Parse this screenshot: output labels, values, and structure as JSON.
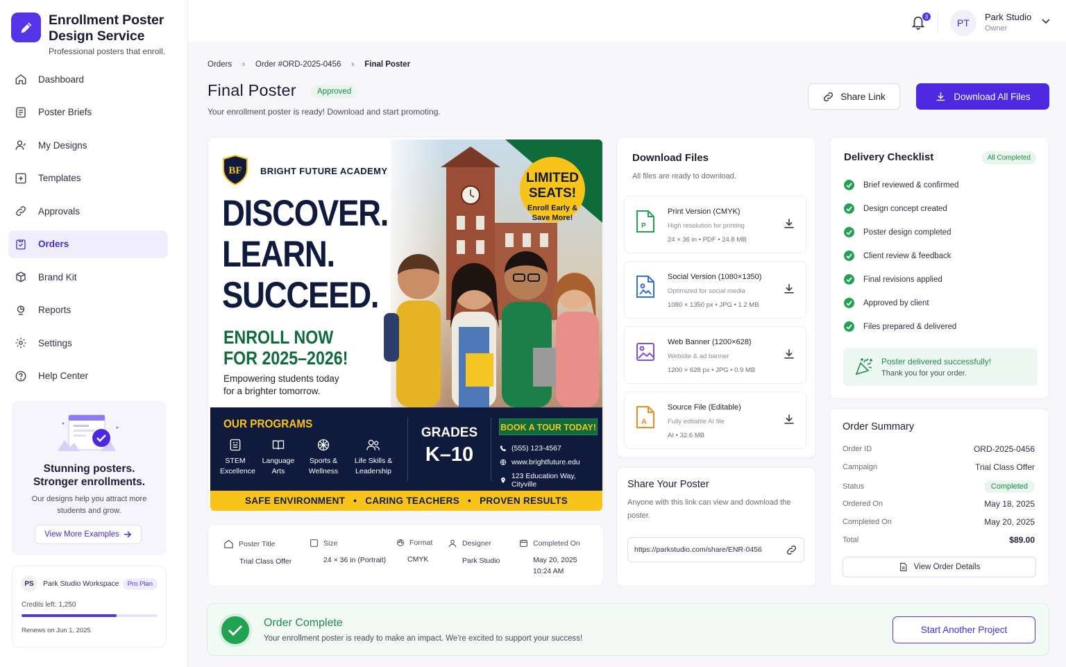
{
  "app": {
    "title": "Enrollment Poster Design Service",
    "title_line1": "Enrollment Poster",
    "title_line2": "Design Service",
    "tagline": "Professional posters that enroll."
  },
  "sidebar": {
    "items": [
      {
        "label": "Dashboard",
        "icon": "home-icon"
      },
      {
        "label": "Poster Briefs",
        "icon": "document-icon"
      },
      {
        "label": "My Designs",
        "icon": "user-icon"
      },
      {
        "label": "Templates",
        "icon": "template-icon"
      },
      {
        "label": "Approvals",
        "icon": "link-icon"
      },
      {
        "label": "Orders",
        "icon": "orders-icon",
        "active": true
      },
      {
        "label": "Brand Kit",
        "icon": "box-icon"
      },
      {
        "label": "Reports",
        "icon": "reports-icon"
      },
      {
        "label": "Settings",
        "icon": "gear-icon"
      },
      {
        "label": "Help Center",
        "icon": "help-icon"
      }
    ],
    "promo": {
      "title_line1": "Stunning posters.",
      "title_line2": "Stronger enrollments.",
      "text": "Our designs help you attract more students and grow.",
      "button": "View More Examples"
    },
    "workspace": {
      "initials": "PS",
      "name": "Park Studio Workspace",
      "plan": "Pro Plan",
      "credits": "Credits left: 1,250",
      "credits_fraction": 0.7,
      "renews": "Renews on Jun 1, 2025"
    }
  },
  "topbar": {
    "notifications": "3",
    "user_initials": "PT",
    "user_name": "Park Studio",
    "user_role": "Owner"
  },
  "breadcrumb": [
    "Orders",
    "Order #ORD-2025-0456",
    "Final Poster"
  ],
  "page": {
    "title": "Final Poster",
    "status": "Approved",
    "subtitle": "Your enrollment poster is ready! Download and start promoting.",
    "share_button": "Share Link",
    "download_button": "Download All Files"
  },
  "poster": {
    "school": "BRIGHT FUTURE ACADEMY",
    "logo_text": "BF",
    "headline": [
      "DISCOVER.",
      "LEARN.",
      "SUCCEED."
    ],
    "enroll": [
      "ENROLL NOW",
      "FOR 2025–2026!"
    ],
    "tagline": [
      "Empowering students today",
      "for a brighter tomorrow."
    ],
    "seats": [
      "LIMITED",
      "SEATS!"
    ],
    "seats_sub": [
      "Enroll Early &",
      "Save More!"
    ],
    "programs_title": "OUR PROGRAMS",
    "programs": [
      {
        "l1": "STEM",
        "l2": "Excellence"
      },
      {
        "l1": "Language",
        "l2": "Arts"
      },
      {
        "l1": "Sports &",
        "l2": "Wellness"
      },
      {
        "l1": "Life Skills &",
        "l2": "Leadership"
      }
    ],
    "grades": "GRADES",
    "grades_range": "K–10",
    "book": "BOOK A TOUR TODAY!",
    "phone": "(555) 123-4567",
    "web": "www.brightfuture.edu",
    "address": "123 Education Way, Cityville",
    "footer": [
      "SAFE ENVIRONMENT",
      "CARING TEACHERS",
      "PROVEN RESULTS"
    ]
  },
  "details": [
    {
      "label": "Poster Title",
      "value": "Trial Class Offer"
    },
    {
      "label": "Size",
      "value": "24 × 36 in (Portrait)"
    },
    {
      "label": "Format",
      "value": "CMYK"
    },
    {
      "label": "Designer",
      "value": "Park Studio"
    },
    {
      "label": "Completed On",
      "value": "May 20, 2025",
      "value2": "10:24 AM"
    }
  ],
  "downloads": {
    "title": "Download Files",
    "subtitle": "All files are ready to download.",
    "files": [
      {
        "name": "Print Version (CMYK)",
        "desc": "High resolution for printing",
        "meta": "24 × 36 in  •  PDF  •  24.8 MB",
        "color": "#22a354"
      },
      {
        "name": "Social Version (1080×1350)",
        "desc": "Optimized for social media",
        "meta": "1080 × 1350 px  •  JPG  •  1.2 MB",
        "color": "#2f6fe0"
      },
      {
        "name": "Web Banner (1200×628)",
        "desc": "Website & ad banner",
        "meta": "1200 × 628 px  •  JPG  •  0.9 MB",
        "color": "#7a4fe0"
      },
      {
        "name": "Source File (Editable)",
        "desc": "Fully editable AI file",
        "meta": "AI  •  32.6 MB",
        "color": "#f08a1a"
      }
    ]
  },
  "share": {
    "title": "Share Your Poster",
    "text": "Anyone with this link can view and download the poster.",
    "url": "https://parkstudio.com/share/ENR-0456"
  },
  "checklist": {
    "title": "Delivery Checklist",
    "badge": "All Completed",
    "items": [
      "Brief reviewed & confirmed",
      "Design concept created",
      "Poster design completed",
      "Client review & feedback",
      "Final revisions applied",
      "Approved by client",
      "Files prepared & delivered"
    ],
    "success_title": "Poster delivered successfully!",
    "success_text": "Thank you for your order."
  },
  "summary": {
    "title": "Order Summary",
    "rows": [
      {
        "label": "Order ID",
        "value": "ORD-2025-0456"
      },
      {
        "label": "Campaign",
        "value": "Trial Class Offer"
      },
      {
        "label": "Status",
        "value": "Completed"
      },
      {
        "label": "Ordered On",
        "value": "May 18, 2025"
      },
      {
        "label": "Completed On",
        "value": "May 20, 2025"
      },
      {
        "label": "Total",
        "value": "$89.00"
      }
    ],
    "button": "View Order Details"
  },
  "complete": {
    "title": "Order Complete",
    "text": "Your enrollment poster is ready to make an impact. We're excited to support your success!",
    "button": "Start Another Project"
  },
  "colors": {
    "accent": "#4c28e0",
    "success": "#22a354",
    "navy": "#0f1a3d",
    "yellow": "#f9c41a",
    "green": "#0f6b3b"
  }
}
